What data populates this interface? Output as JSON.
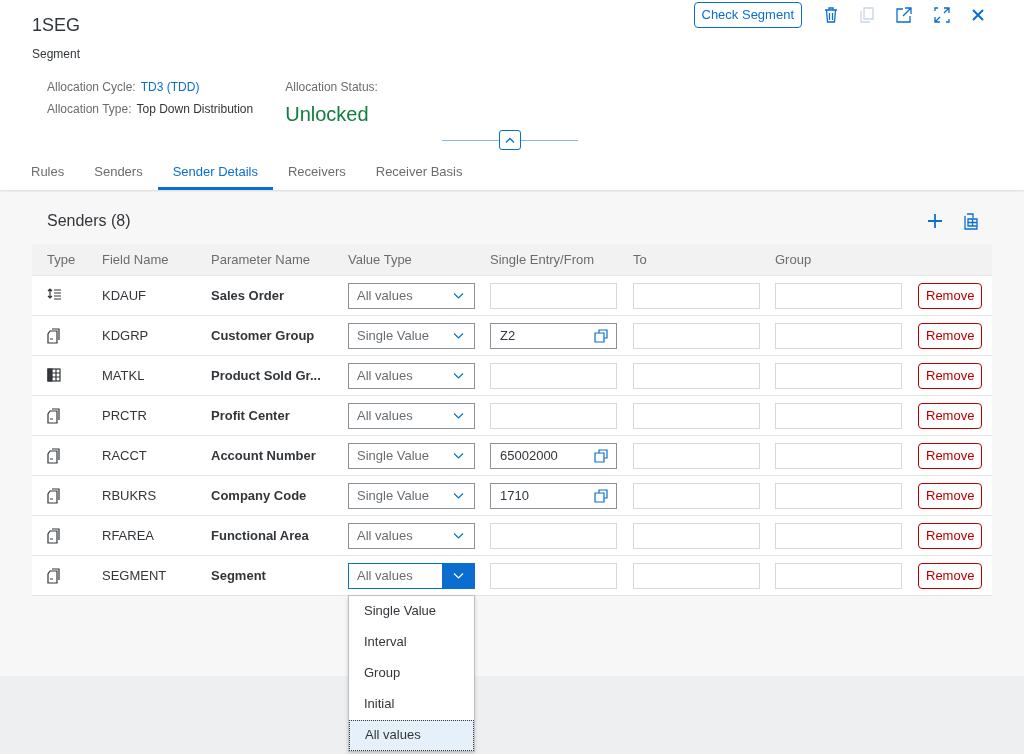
{
  "header": {
    "title": "1SEG",
    "subtitle": "Segment",
    "actions": {
      "check_button": "Check Segment"
    },
    "fields": [
      {
        "label": "Allocation Cycle:",
        "value": "TD3 (TDD)",
        "kind": "link"
      },
      {
        "label": "Allocation Type:",
        "value": "Top Down Distribution",
        "kind": "text"
      }
    ],
    "status": {
      "label": "Allocation Status:",
      "value": "Unlocked"
    }
  },
  "tabs": [
    {
      "label": "Rules",
      "selected": false
    },
    {
      "label": "Senders",
      "selected": false
    },
    {
      "label": "Sender Details",
      "selected": true
    },
    {
      "label": "Receivers",
      "selected": false
    },
    {
      "label": "Receiver Basis",
      "selected": false
    }
  ],
  "table": {
    "title": "Senders (8)",
    "columns": [
      "Type",
      "Field Name",
      "Parameter Name",
      "Value Type",
      "Single Entry/From",
      "To",
      "Group"
    ],
    "rows": [
      {
        "kind": "hierarchy",
        "field": "KDAUF",
        "parameter": "Sales Order",
        "value_type": "All values",
        "open": false,
        "from": "",
        "remove": "Remove"
      },
      {
        "kind": "document",
        "field": "KDGRP",
        "parameter": "Customer Group",
        "value_type": "Single Value",
        "open": false,
        "from": "Z2",
        "remove": "Remove"
      },
      {
        "kind": "table",
        "field": "MATKL",
        "parameter": "Product Sold Gr...",
        "value_type": "All values",
        "open": false,
        "from": "",
        "remove": "Remove"
      },
      {
        "kind": "document",
        "field": "PRCTR",
        "parameter": "Profit Center",
        "value_type": "All values",
        "open": false,
        "from": "",
        "remove": "Remove"
      },
      {
        "kind": "document",
        "field": "RACCT",
        "parameter": "Account Number",
        "value_type": "Single Value",
        "open": false,
        "from": "65002000",
        "remove": "Remove"
      },
      {
        "kind": "document",
        "field": "RBUKRS",
        "parameter": "Company Code",
        "value_type": "Single Value",
        "open": false,
        "from": "1710",
        "remove": "Remove"
      },
      {
        "kind": "document",
        "field": "RFAREA",
        "parameter": "Functional Area",
        "value_type": "All values",
        "open": false,
        "from": "",
        "remove": "Remove"
      },
      {
        "kind": "document",
        "field": "SEGMENT",
        "parameter": "Segment",
        "value_type": "All values",
        "open": true,
        "from": "",
        "remove": "Remove"
      }
    ]
  },
  "dropdown_options": [
    {
      "label": "Single Value",
      "selected": false
    },
    {
      "label": "Interval",
      "selected": false
    },
    {
      "label": "Group",
      "selected": false
    },
    {
      "label": "Initial",
      "selected": false
    },
    {
      "label": "All values",
      "selected": true
    }
  ]
}
